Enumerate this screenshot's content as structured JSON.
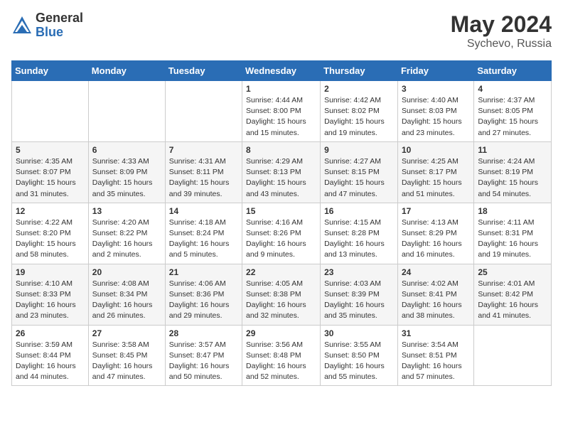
{
  "header": {
    "logo_general": "General",
    "logo_blue": "Blue",
    "month_year": "May 2024",
    "location": "Sychevo, Russia"
  },
  "calendar": {
    "days_of_week": [
      "Sunday",
      "Monday",
      "Tuesday",
      "Wednesday",
      "Thursday",
      "Friday",
      "Saturday"
    ],
    "weeks": [
      [
        {
          "day": "",
          "info": ""
        },
        {
          "day": "",
          "info": ""
        },
        {
          "day": "",
          "info": ""
        },
        {
          "day": "1",
          "info": "Sunrise: 4:44 AM\nSunset: 8:00 PM\nDaylight: 15 hours\nand 15 minutes."
        },
        {
          "day": "2",
          "info": "Sunrise: 4:42 AM\nSunset: 8:02 PM\nDaylight: 15 hours\nand 19 minutes."
        },
        {
          "day": "3",
          "info": "Sunrise: 4:40 AM\nSunset: 8:03 PM\nDaylight: 15 hours\nand 23 minutes."
        },
        {
          "day": "4",
          "info": "Sunrise: 4:37 AM\nSunset: 8:05 PM\nDaylight: 15 hours\nand 27 minutes."
        }
      ],
      [
        {
          "day": "5",
          "info": "Sunrise: 4:35 AM\nSunset: 8:07 PM\nDaylight: 15 hours\nand 31 minutes."
        },
        {
          "day": "6",
          "info": "Sunrise: 4:33 AM\nSunset: 8:09 PM\nDaylight: 15 hours\nand 35 minutes."
        },
        {
          "day": "7",
          "info": "Sunrise: 4:31 AM\nSunset: 8:11 PM\nDaylight: 15 hours\nand 39 minutes."
        },
        {
          "day": "8",
          "info": "Sunrise: 4:29 AM\nSunset: 8:13 PM\nDaylight: 15 hours\nand 43 minutes."
        },
        {
          "day": "9",
          "info": "Sunrise: 4:27 AM\nSunset: 8:15 PM\nDaylight: 15 hours\nand 47 minutes."
        },
        {
          "day": "10",
          "info": "Sunrise: 4:25 AM\nSunset: 8:17 PM\nDaylight: 15 hours\nand 51 minutes."
        },
        {
          "day": "11",
          "info": "Sunrise: 4:24 AM\nSunset: 8:19 PM\nDaylight: 15 hours\nand 54 minutes."
        }
      ],
      [
        {
          "day": "12",
          "info": "Sunrise: 4:22 AM\nSunset: 8:20 PM\nDaylight: 15 hours\nand 58 minutes."
        },
        {
          "day": "13",
          "info": "Sunrise: 4:20 AM\nSunset: 8:22 PM\nDaylight: 16 hours\nand 2 minutes."
        },
        {
          "day": "14",
          "info": "Sunrise: 4:18 AM\nSunset: 8:24 PM\nDaylight: 16 hours\nand 5 minutes."
        },
        {
          "day": "15",
          "info": "Sunrise: 4:16 AM\nSunset: 8:26 PM\nDaylight: 16 hours\nand 9 minutes."
        },
        {
          "day": "16",
          "info": "Sunrise: 4:15 AM\nSunset: 8:28 PM\nDaylight: 16 hours\nand 13 minutes."
        },
        {
          "day": "17",
          "info": "Sunrise: 4:13 AM\nSunset: 8:29 PM\nDaylight: 16 hours\nand 16 minutes."
        },
        {
          "day": "18",
          "info": "Sunrise: 4:11 AM\nSunset: 8:31 PM\nDaylight: 16 hours\nand 19 minutes."
        }
      ],
      [
        {
          "day": "19",
          "info": "Sunrise: 4:10 AM\nSunset: 8:33 PM\nDaylight: 16 hours\nand 23 minutes."
        },
        {
          "day": "20",
          "info": "Sunrise: 4:08 AM\nSunset: 8:34 PM\nDaylight: 16 hours\nand 26 minutes."
        },
        {
          "day": "21",
          "info": "Sunrise: 4:06 AM\nSunset: 8:36 PM\nDaylight: 16 hours\nand 29 minutes."
        },
        {
          "day": "22",
          "info": "Sunrise: 4:05 AM\nSunset: 8:38 PM\nDaylight: 16 hours\nand 32 minutes."
        },
        {
          "day": "23",
          "info": "Sunrise: 4:03 AM\nSunset: 8:39 PM\nDaylight: 16 hours\nand 35 minutes."
        },
        {
          "day": "24",
          "info": "Sunrise: 4:02 AM\nSunset: 8:41 PM\nDaylight: 16 hours\nand 38 minutes."
        },
        {
          "day": "25",
          "info": "Sunrise: 4:01 AM\nSunset: 8:42 PM\nDaylight: 16 hours\nand 41 minutes."
        }
      ],
      [
        {
          "day": "26",
          "info": "Sunrise: 3:59 AM\nSunset: 8:44 PM\nDaylight: 16 hours\nand 44 minutes."
        },
        {
          "day": "27",
          "info": "Sunrise: 3:58 AM\nSunset: 8:45 PM\nDaylight: 16 hours\nand 47 minutes."
        },
        {
          "day": "28",
          "info": "Sunrise: 3:57 AM\nSunset: 8:47 PM\nDaylight: 16 hours\nand 50 minutes."
        },
        {
          "day": "29",
          "info": "Sunrise: 3:56 AM\nSunset: 8:48 PM\nDaylight: 16 hours\nand 52 minutes."
        },
        {
          "day": "30",
          "info": "Sunrise: 3:55 AM\nSunset: 8:50 PM\nDaylight: 16 hours\nand 55 minutes."
        },
        {
          "day": "31",
          "info": "Sunrise: 3:54 AM\nSunset: 8:51 PM\nDaylight: 16 hours\nand 57 minutes."
        },
        {
          "day": "",
          "info": ""
        }
      ]
    ]
  }
}
